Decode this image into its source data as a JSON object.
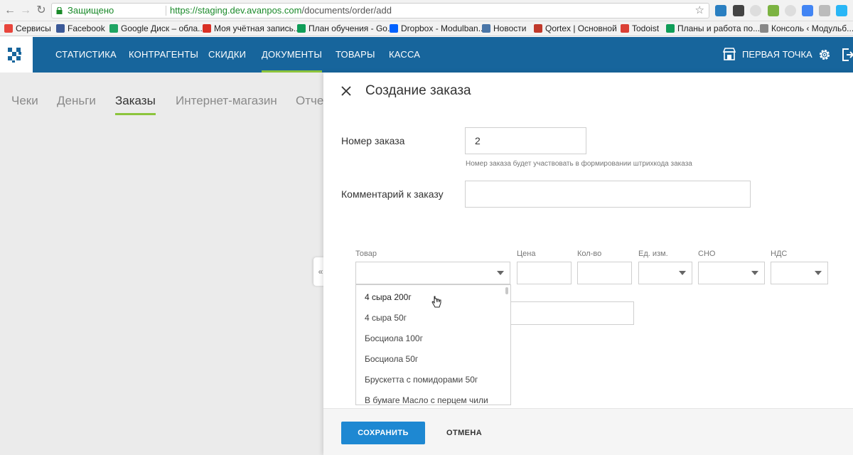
{
  "browser": {
    "secure_label": "Защищено",
    "url_host": "https://staging.dev.avanpos.com",
    "url_path": "/documents/order/add",
    "bookmarks": [
      {
        "label": "Сервисы",
        "color": "#e8453c"
      },
      {
        "label": "Facebook",
        "color": "#3b5998"
      },
      {
        "label": "Google Диск – обла...",
        "color": "#1fa463"
      },
      {
        "label": "Моя учётная запись...",
        "color": "#d93025"
      },
      {
        "label": "План обучения - Go...",
        "color": "#0f9d58"
      },
      {
        "label": "Dropbox - Modulban...",
        "color": "#0061ff"
      },
      {
        "label": "Новости",
        "color": "#4a76a8"
      },
      {
        "label": "Qortex | Основной",
        "color": "#c0392b"
      },
      {
        "label": "Todoist",
        "color": "#db4035"
      },
      {
        "label": "Планы и работа по...",
        "color": "#0f9d58"
      },
      {
        "label": "Консоль ‹ Модульб...",
        "color": "#888888"
      }
    ]
  },
  "header": {
    "nav": [
      {
        "label": "СТАТИСТИКА"
      },
      {
        "label": "КОНТРАГЕНТЫ"
      },
      {
        "label": "СКИДКИ"
      },
      {
        "label": "ДОКУМЕНТЫ",
        "active": true
      },
      {
        "label": "ТОВАРЫ"
      },
      {
        "label": "КАССА"
      }
    ],
    "store_name": "ПЕРВАЯ ТОЧКА",
    "accent": "#17659c",
    "active_underline": "#8cc43c"
  },
  "subtabs": [
    {
      "label": "Чеки"
    },
    {
      "label": "Деньги"
    },
    {
      "label": "Заказы",
      "active": true
    },
    {
      "label": "Интернет-магазин"
    },
    {
      "label": "Отче"
    }
  ],
  "collapse_label": "«",
  "drawer": {
    "title": "Создание заказа",
    "order_number_label": "Номер заказа",
    "order_number_value": "2",
    "order_number_hint": "Номер заказа будет участвовать в формировании штрихкода заказа",
    "comment_label": "Комментарий к заказу",
    "comment_value": "",
    "columns": {
      "product": "Товар",
      "price": "Цена",
      "qty": "Кол-во",
      "unit": "Ед. изм.",
      "sno": "СНО",
      "vat": "НДС"
    },
    "product_options": [
      "4 сыра 200г",
      "4 сыра 50г",
      "Босциола 100г",
      "Босциола 50г",
      "Брускетта с помидорами 50г",
      "В бумаге Масло с перцем чили"
    ],
    "save_label": "СОХРАНИТЬ",
    "cancel_label": "ОТМЕНА",
    "save_color": "#1e88d2"
  }
}
